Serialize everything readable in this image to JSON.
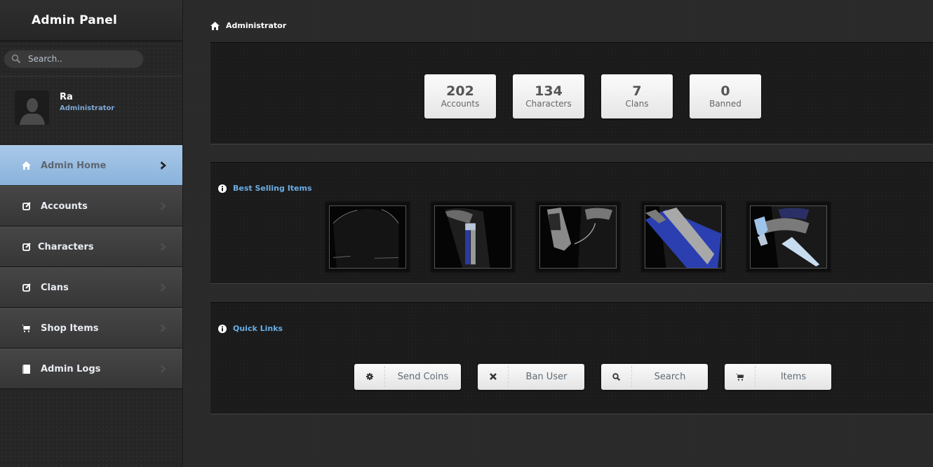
{
  "sidebar": {
    "title": "Admin Panel",
    "search": {
      "placeholder": "Search..",
      "value": ""
    },
    "profile": {
      "name": "Ra",
      "role": "Administrator"
    },
    "items": [
      {
        "label": "Admin Home",
        "icon": "home-icon",
        "active": true
      },
      {
        "label": "Accounts",
        "icon": "edit-icon",
        "active": false
      },
      {
        "label": "Characters",
        "icon": "edit-icon",
        "active": false
      },
      {
        "label": "Clans",
        "icon": "edit-icon",
        "active": false
      },
      {
        "label": "Shop Items",
        "icon": "cart-icon",
        "active": false
      },
      {
        "label": "Admin Logs",
        "icon": "book-icon",
        "active": false
      }
    ]
  },
  "breadcrumb": {
    "label": "Administrator",
    "icon": "home-icon"
  },
  "stats": [
    {
      "value": "202",
      "label": "Accounts"
    },
    {
      "value": "134",
      "label": "Characters"
    },
    {
      "value": "7",
      "label": "Clans"
    },
    {
      "value": "0",
      "label": "Banned"
    }
  ],
  "best_selling": {
    "title": "Best Selling Items",
    "icon": "info-icon",
    "items": [
      {
        "name": "item-1",
        "accent": "#3a3a3a"
      },
      {
        "name": "item-2",
        "accent": "#2a3aa8"
      },
      {
        "name": "item-3",
        "accent": "#9a9a9a"
      },
      {
        "name": "item-4",
        "accent": "#2b3fb0"
      },
      {
        "name": "item-5",
        "accent": "#9ec4ea"
      }
    ]
  },
  "quick_links": {
    "title": "Quick Links",
    "icon": "info-icon",
    "buttons": [
      {
        "label": "Send Coins",
        "icon": "gear-icon"
      },
      {
        "label": "Ban User",
        "icon": "close-icon"
      },
      {
        "label": "Search",
        "icon": "search-icon"
      },
      {
        "label": "Items",
        "icon": "cart-icon"
      }
    ]
  },
  "colors": {
    "accent_link": "#6aaee6",
    "active_nav": "#8ab2dc",
    "role_text": "#7fa9d6"
  }
}
